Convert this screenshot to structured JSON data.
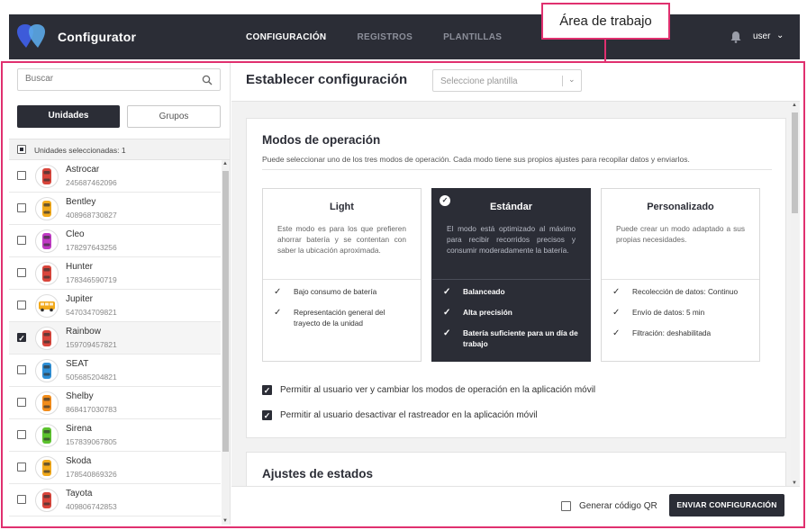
{
  "header": {
    "brand": "Configurator",
    "nav": [
      {
        "label": "CONFIGURACIÓN",
        "active": true
      },
      {
        "label": "REGISTROS",
        "active": false
      },
      {
        "label": "PLANTILLAS",
        "active": false
      }
    ],
    "user": "user"
  },
  "callout": {
    "label": "Área de trabajo",
    "color": "#e0306f"
  },
  "sidebar": {
    "search_placeholder": "Buscar",
    "tabs": {
      "units": "Unidades",
      "groups": "Grupos"
    },
    "selected_label": "Unidades seleccionadas: 1",
    "units": [
      {
        "name": "Astrocar",
        "id": "245687462096",
        "checked": false,
        "color": "#d9453b",
        "icon": "car-icon"
      },
      {
        "name": "Bentley",
        "id": "408968730827",
        "checked": false,
        "color": "#f2a91a",
        "icon": "car-icon"
      },
      {
        "name": "Cleo",
        "id": "178297643256",
        "checked": false,
        "color": "#c03ac4",
        "icon": "car-icon"
      },
      {
        "name": "Hunter",
        "id": "178346590719",
        "checked": false,
        "color": "#d9453b",
        "icon": "car-icon"
      },
      {
        "name": "Jupiter",
        "id": "547034709821",
        "checked": false,
        "color": "#f2a91a",
        "icon": "bus-icon"
      },
      {
        "name": "Rainbow",
        "id": "159709457821",
        "checked": true,
        "color": "#d9453b",
        "icon": "car-icon"
      },
      {
        "name": "SEAT",
        "id": "505685204821",
        "checked": false,
        "color": "#2e8fd6",
        "icon": "car-icon"
      },
      {
        "name": "Shelby",
        "id": "868417030783",
        "checked": false,
        "color": "#f28c1a",
        "icon": "car-icon"
      },
      {
        "name": "Sirena",
        "id": "157839067805",
        "checked": false,
        "color": "#5cc22e",
        "icon": "car-icon"
      },
      {
        "name": "Skoda",
        "id": "178540869326",
        "checked": false,
        "color": "#f2a91a",
        "icon": "car-icon"
      },
      {
        "name": "Tayota",
        "id": "409806742853",
        "checked": false,
        "color": "#d9453b",
        "icon": "car-icon"
      }
    ]
  },
  "main": {
    "title": "Establecer configuración",
    "template_placeholder": "Seleccione plantilla",
    "modes_section": {
      "title": "Modos de operación",
      "description": "Puede seleccionar uno de los tres modos de operación. Cada modo tiene sus propios ajustes para recopilar datos y enviarlos.",
      "modes": [
        {
          "title": "Light",
          "description": "Este modo es para los que prefieren ahorrar batería y se contentan con saber la ubicación aproximada.",
          "features": [
            "Bajo consumo de batería",
            "Representación general del trayecto de la unidad"
          ],
          "selected": false
        },
        {
          "title": "Estándar",
          "description": "El modo está optimizado al máximo para recibir recorridos precisos y consumir moderadamente la batería.",
          "features": [
            "Balanceado",
            "Alta precisión",
            "Batería suficiente para un día de trabajo"
          ],
          "selected": true
        },
        {
          "title": "Personalizado",
          "description": "Puede crear un modo adaptado a sus propias necesidades.",
          "features": [
            "Recolección de datos: Continuo",
            "Envío de datos: 5 min",
            "Filtración: deshabilitada"
          ],
          "selected": false
        }
      ],
      "options": [
        {
          "label": "Permitir al usuario ver y cambiar los modos de operación en la aplicación móvil",
          "checked": true
        },
        {
          "label": "Permitir al usuario desactivar el rastreador en la aplicación móvil",
          "checked": true
        }
      ]
    },
    "states_section": {
      "title": "Ajustes de estados"
    },
    "footer": {
      "qr_label": "Generar código QR",
      "qr_checked": false,
      "send_label": "ENVIAR CONFIGURACIÓN"
    }
  }
}
